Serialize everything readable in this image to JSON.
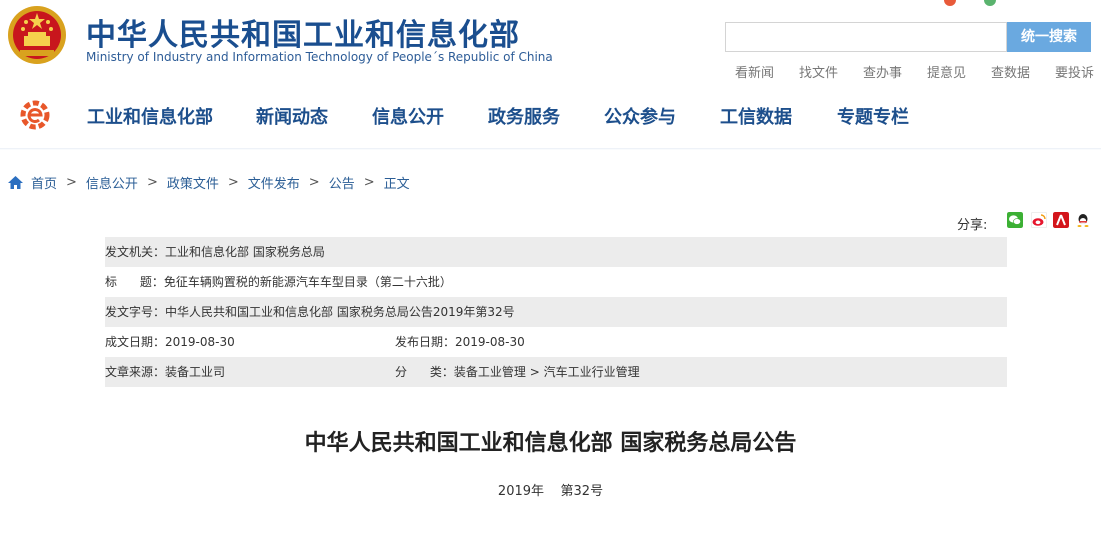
{
  "header": {
    "title": "中华人民共和国工业和信息化部",
    "subtitle": "Ministry of Industry and Information Technology of People´s Republic of China",
    "search_button": "统一搜索",
    "search_value": "",
    "quick_links": [
      "看新闻",
      "找文件",
      "查办事",
      "提意见",
      "查数据",
      "要投诉"
    ]
  },
  "nav": {
    "items": [
      "工业和信息化部",
      "新闻动态",
      "信息公开",
      "政务服务",
      "公众参与",
      "工信数据",
      "专题专栏"
    ]
  },
  "breadcrumb": [
    "首页",
    "信息公开",
    "政策文件",
    "文件发布",
    "公告",
    "正文"
  ],
  "breadcrumb_sep": ">",
  "share": {
    "label": "分享:",
    "icons": [
      "wechat-icon",
      "weibo-icon",
      "renren-icon",
      "qq-icon"
    ]
  },
  "meta": {
    "issuer": "发文机关：工业和信息化部 国家税务总局",
    "title": "标      题：免征车辆购置税的新能源汽车车型目录（第二十六批）",
    "doc_no": "发文字号：中华人民共和国工业和信息化部 国家税务总局公告2019年第32号",
    "created": "成文日期：2019-08-30",
    "published": "发布日期：2019-08-30",
    "source": "文章来源：装备工业司",
    "category": "分      类：装备工业管理 > 汽车工业行业管理"
  },
  "article": {
    "title": "中华人民共和国工业和信息化部 国家税务总局公告",
    "number": "2019年    第32号"
  },
  "colors": {
    "brand_blue": "#1a4e8f",
    "search_button": "#6aa9e0",
    "meta_grey": "#ececec"
  }
}
